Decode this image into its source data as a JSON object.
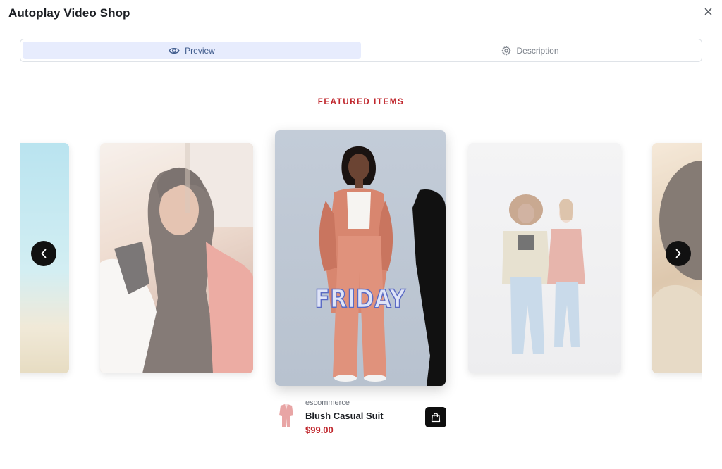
{
  "modal": {
    "title": "Autoplay Video Shop"
  },
  "icons": {
    "close": "close-icon",
    "preview": "eye-icon",
    "description": "gear-icon",
    "prev": "chevron-left-icon",
    "next": "chevron-right-icon",
    "bag": "shopping-bag-icon"
  },
  "tabs": [
    {
      "label": "Preview",
      "active": true
    },
    {
      "label": "Description",
      "active": false
    }
  ],
  "section": {
    "heading": "FEATURED ITEMS"
  },
  "carousel": {
    "active_overlay_text": "FRIDAY"
  },
  "product": {
    "vendor": "escommerce",
    "name": "Blush Casual Suit",
    "price": "$99.00"
  },
  "colors": {
    "accent_red": "#c0272d",
    "active_tab_bg": "#e7ecfd",
    "active_tab_text": "#3f5b8c",
    "button_dark": "#0e0e0e"
  }
}
